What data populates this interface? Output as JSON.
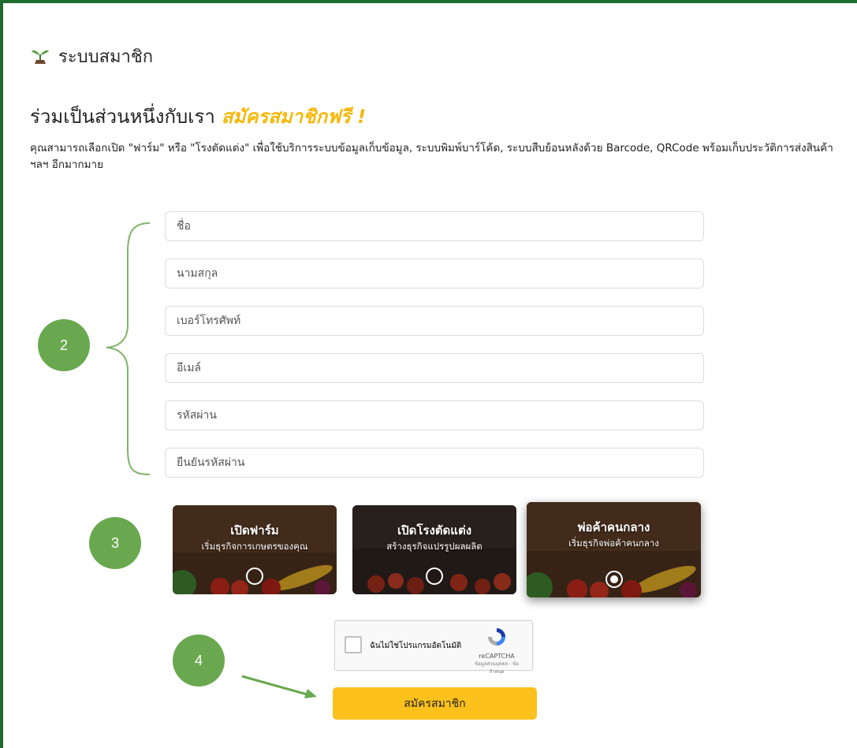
{
  "header": {
    "logo_text": "ระบบสมาชิก"
  },
  "headline": {
    "text": "ร่วมเป็นส่วนหนึ่งกับเรา",
    "highlight": "สมัครสมาชิกฟรี !"
  },
  "description": "คุณสามารถเลือกเปิด \"ฟาร์ม\" หรือ \"โรงตัดแต่ง\" เพื่อใช้บริการระบบข้อมูลเก็บข้อมูล, ระบบพิมพ์บาร์โค้ด, ระบบสืบย้อนหลังด้วย Barcode, QRCode พร้อมเก็บประวัติการส่งสินค้า ฯลฯ อีกมากมาย",
  "form": {
    "first_name": {
      "placeholder": "ชื่อ",
      "value": ""
    },
    "last_name": {
      "placeholder": "นามสกุล",
      "value": ""
    },
    "phone": {
      "placeholder": "เบอร์โทรศัพท์",
      "value": ""
    },
    "email": {
      "placeholder": "อีเมล์",
      "value": ""
    },
    "password": {
      "placeholder": "รหัสผ่าน",
      "value": ""
    },
    "confirm_password": {
      "placeholder": "ยืนยันรหัสผ่าน",
      "value": ""
    }
  },
  "account_types": [
    {
      "title": "เปิดฟาร์ม",
      "subtitle": "เริ่มธุรกิจการเกษตรของคุณ",
      "selected": false
    },
    {
      "title": "เปิดโรงตัดแต่ง",
      "subtitle": "สร้างธุรกิจแปรรูปผลผลิต",
      "selected": false
    },
    {
      "title": "พ่อค้าคนกลาง",
      "subtitle": "เริ่มธุรกิจพ่อค้าคนกลาง",
      "selected": true
    }
  ],
  "captcha": {
    "label": "ฉันไม่ใช่โปรแกรมอัตโนมัติ",
    "brand": "reCAPTCHA",
    "terms": "ข้อมูลส่วนบุคคล - ข้อกำหนด"
  },
  "submit_label": "สมัครสมาชิก",
  "annotations": {
    "step2": "2",
    "step3": "3",
    "step4": "4"
  },
  "colors": {
    "accent": "#fcc11c",
    "brand_green": "#1f6a2e",
    "badge": "#6aa84f"
  },
  "icons": {
    "logo": "sprout-icon"
  }
}
